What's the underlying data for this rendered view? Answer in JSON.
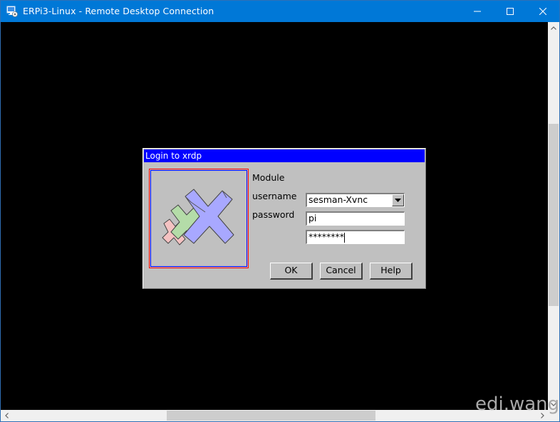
{
  "window": {
    "title": "ERPi3-Linux - Remote Desktop Connection",
    "controls": {
      "minimize": "minimize-icon",
      "maximize": "maximize-icon",
      "close": "close-icon"
    }
  },
  "dialog": {
    "title": "Login to xrdp",
    "fields": {
      "module_label": "Module",
      "module_value": "sesman-Xvnc",
      "username_label": "username",
      "username_value": "pi",
      "password_label": "password",
      "password_value": "********"
    },
    "buttons": {
      "ok": "OK",
      "cancel": "Cancel",
      "help": "Help"
    }
  },
  "watermark": "edi.wang",
  "colors": {
    "titlebar": "#0078d7",
    "dialog_title": "#0000ff",
    "dialog_bg": "#c0c0c0",
    "desktop_bg": "#000000"
  }
}
